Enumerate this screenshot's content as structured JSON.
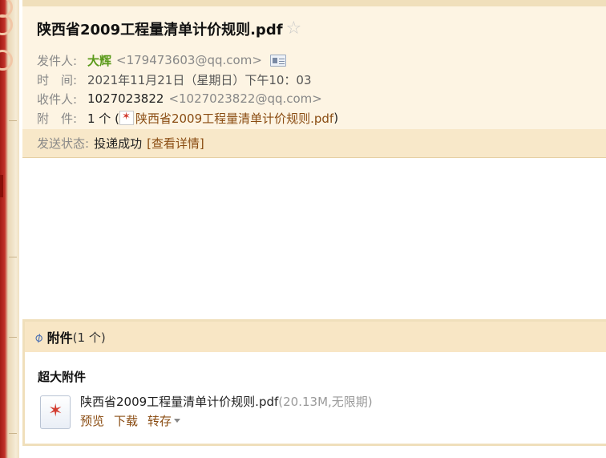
{
  "header": {
    "subject": "陕西省2009工程量清单计价规则.pdf",
    "sender_label": "发件人:",
    "sender_name": "大辉",
    "sender_email": "<179473603@qq.com>",
    "time_label": "时　间:",
    "time_value": "2021年11月21日（星期日）下午10：03",
    "recipient_label": "收件人:",
    "recipient_name": "1027023822",
    "recipient_email": "<1027023822@qq.com>",
    "attach_label": "附　件:",
    "attach_count": "1 个 (",
    "attach_file": "陕西省2009工程量清单计价规则.pdf",
    "attach_close": ")"
  },
  "status": {
    "label": "发送状态:",
    "value": "投递成功",
    "link": "[查看详情]"
  },
  "attachments": {
    "title": "附件",
    "count": "(1 个)",
    "section_label": "超大附件",
    "file_name": "陕西省2009工程量清单计价规则.pdf",
    "file_meta": "(20.13M,无限期)",
    "actions": [
      "预览",
      "下载",
      "转存"
    ]
  },
  "icons": {
    "star": "star-outline-icon",
    "contact_card": "contact-card-icon",
    "pdf": "pdf-icon",
    "paperclip": "paperclip-icon",
    "dropdown": "chevron-down-icon"
  },
  "colors": {
    "header_bg": "#fdf4e3",
    "status_bg": "#f8e8c9",
    "sender_name": "#5a9a1a",
    "link": "#8a4c12",
    "frame_red": "#a31b15"
  }
}
